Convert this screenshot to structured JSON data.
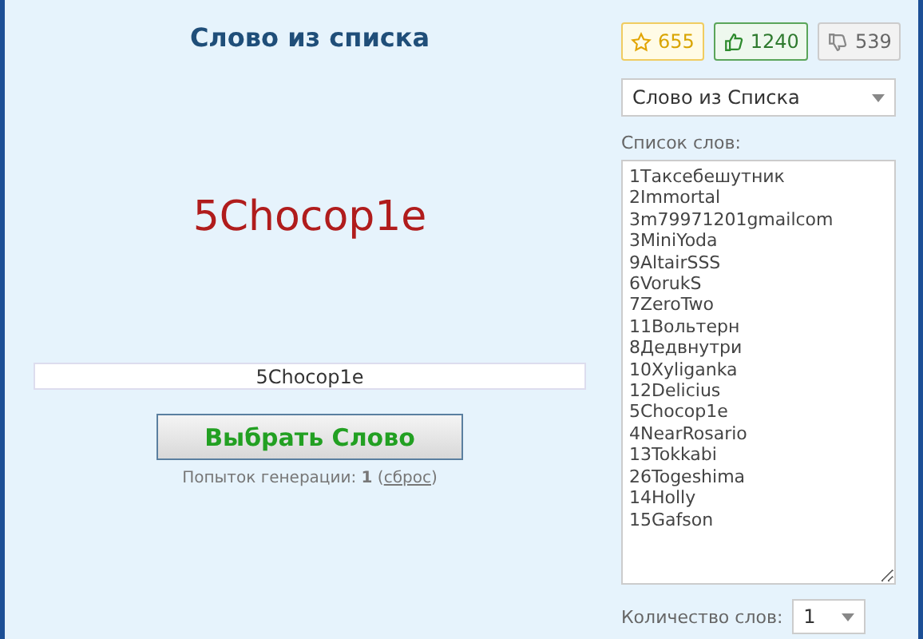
{
  "title": "Слово из списка",
  "result_word": "5Chocop1e",
  "result_field": {
    "value": "5Chocop1e"
  },
  "pick_button": "Выбрать Слово",
  "attempts": {
    "before": "Попыток генерации: **1** (",
    "link": "сброс",
    "after": ")"
  },
  "ratings": [
    {
      "kind": "star",
      "count": "655"
    },
    {
      "kind": "like",
      "count": "1240"
    },
    {
      "kind": "dislike",
      "count": "539"
    }
  ],
  "mode_select": {
    "value": "Слово из Списка"
  },
  "list_label": "Список слов:",
  "words": [
    "1Таксебешутник",
    "2Immortal",
    "3m79971201gmailcom",
    "3MiniYoda",
    "9AltairSSS",
    "6VorukS",
    "7ZeroTwo",
    "11Вольтерн",
    "8Дедвнутри",
    "10Xyliganka",
    "12Delicius",
    "5Chocop1e",
    "4NearRosario",
    "13Tokkabi",
    "26Togeshima",
    "14Holly",
    "15Gafson"
  ],
  "count_label": "Количество слов:",
  "count_select": {
    "value": "1"
  }
}
